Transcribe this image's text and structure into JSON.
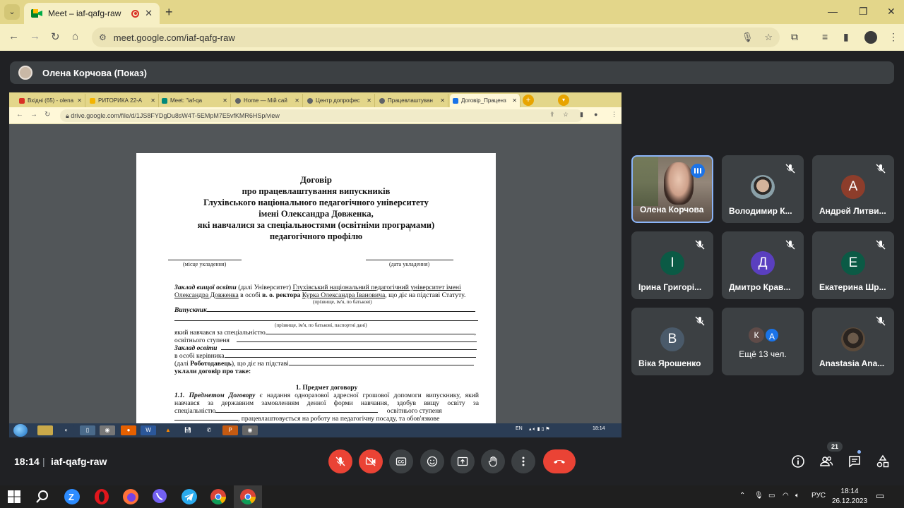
{
  "browser": {
    "tab_title": "Meet – iaf-qafg-raw",
    "url": "meet.google.com/iaf-qafg-raw"
  },
  "presenter": {
    "label": "Олена Корчова (Показ)"
  },
  "shared_screen": {
    "tabs": [
      {
        "label": "Вхідні (65) - olena",
        "color": "#d93025"
      },
      {
        "label": "РИТОРИКА 22-А",
        "color": "#f4b400"
      },
      {
        "label": "Meet: \"iaf-qa",
        "color": "#00897b"
      },
      {
        "label": "Home — Мій сай",
        "color": "#5f6368"
      },
      {
        "label": "Центр допрофес",
        "color": "#5f6368"
      },
      {
        "label": "Працевлаштуван",
        "color": "#5f6368"
      },
      {
        "label": "Договір_Праценз",
        "color": "#1a73e8"
      }
    ],
    "url": "drive.google.com/file/d/1JS8FYDgDu8sW4T-5EMpM7E5vfKMR6HSp/view",
    "document": {
      "title_lines": [
        "Договір",
        "про працевлаштування випускників",
        "Глухівського національного педагогічного університету",
        "імені Олександра Довженка,",
        "які навчалися за спеціальностями (освітніми програмами)",
        "педагогічного профілю"
      ],
      "place_caption": "(місце укладення)",
      "date_caption": "(дата укладення)",
      "zvo_label": "Заклад вищої освіти",
      "zvo_text": "(далі Університет)",
      "zvo_name_1": "Глухівський національний педагогічний університет імені",
      "zvo_name_2": "Олександра Довженка",
      "in_person": "в особі",
      "rector": "в. о. ректора",
      "rector_name": "Курка Олександра Івановича",
      "statute": ", що діє на підставі Статуту.",
      "name_caption": "(прізвище, ім'я, по батькові)",
      "graduate_label": "Випускник",
      "passport_caption": "(прізвище, ім'я, по батькові, паспортні дані)",
      "specialty": "який навчався за спеціальністю",
      "edu_level": "освітнього ступеня",
      "institution": "Заклад освіти",
      "head": "в особі керівника",
      "employer_pre": "(далі",
      "employer": "Роботодавець",
      "employer_post": "), що діє на підставі",
      "concluded": "уклали договір про таке:",
      "section_title": "1. Предмет договору",
      "clause_num": "1.1.",
      "clause_label": "Предметом Договору",
      "clause_l1": "є надання одноразової адресної грошової допомоги випускнику, який",
      "clause_l2": "навчався за державним замовленням денної форми навчання, здобув вищу освіту за",
      "clause_l3a": "спеціальністю",
      "clause_l3b": "освітнього ступеня",
      "clause_l4": ", працевлаштовується на роботу на педагогічну посаду, та обов'язкове"
    },
    "taskbar": {
      "lang": "EN",
      "time": "18:14"
    }
  },
  "participants": [
    {
      "name": "Олена Корчова",
      "speaking": true
    },
    {
      "name": "Володимир К...",
      "muted": true
    },
    {
      "name": "Андрей Литви...",
      "initial": "А",
      "color": "#8d3d2b",
      "muted": true
    },
    {
      "name": "Ірина Григорі...",
      "initial": "І",
      "color": "#0b5a45",
      "muted": true
    },
    {
      "name": "Дмитро Крав...",
      "initial": "Д",
      "color": "#5a3fbf",
      "muted": true
    },
    {
      "name": "Екатерина Шр...",
      "initial": "Е",
      "color": "#0b5a45",
      "muted": true
    },
    {
      "name": "Віка Ярошенко",
      "initial": "В",
      "color": "#4a5a6a",
      "muted": true
    },
    {
      "more_label": "Ещё 13 чел.",
      "initials": [
        "К",
        "А"
      ]
    },
    {
      "name": "Anastasia Ana...",
      "muted": true
    }
  ],
  "meeting": {
    "time": "18:14",
    "separator": "|",
    "code": "iaf-qafg-raw",
    "people_count": "21"
  },
  "windows": {
    "lang": "РУС",
    "time": "18:14",
    "date": "26.12.2023"
  }
}
